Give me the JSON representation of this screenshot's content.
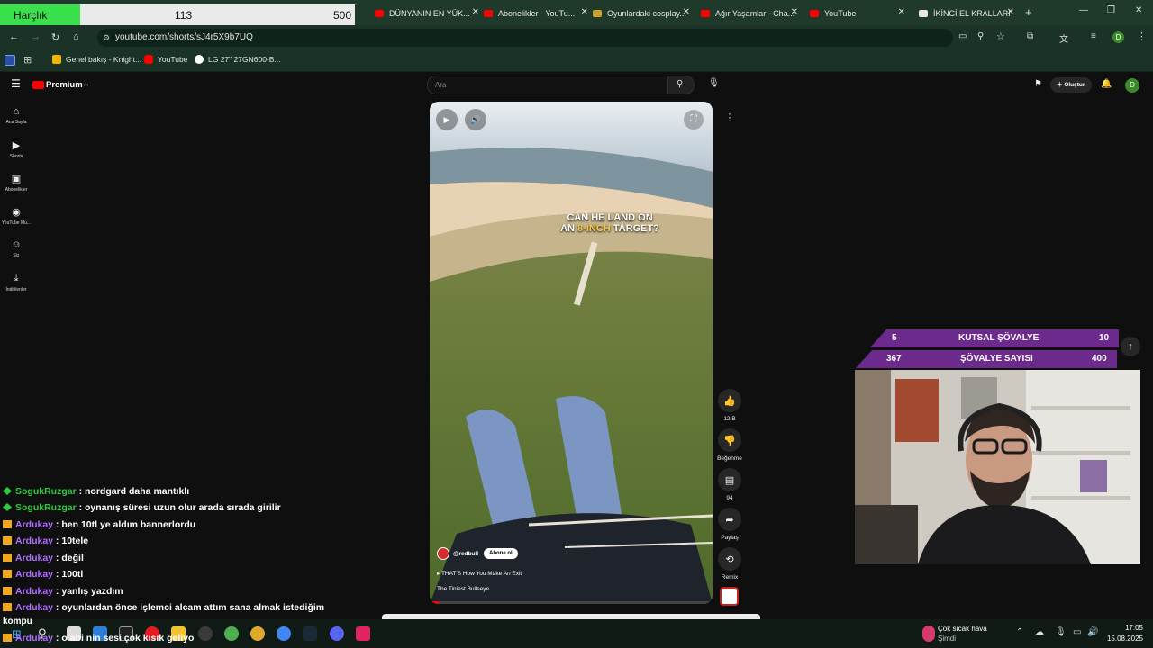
{
  "overlay": {
    "harclik_label": "Harçlık",
    "harclik_current": "113",
    "harclik_max": "500",
    "harclik_progress": 0.226,
    "kutsal_count": "5",
    "kutsal_label": "KUTSAL ŞÖVALYE",
    "kutsal_max": "10",
    "sovalye_count": "367",
    "sovalye_label": "ŞÖVALYE SAYISI",
    "sovalye_max": "400"
  },
  "browser": {
    "tabs": [
      {
        "label": "DÜNYANIN EN YÜK..."
      },
      {
        "label": "Abonelikler - YouTu..."
      },
      {
        "label": "Oyunlardaki cosplay..."
      },
      {
        "label": "Ağır Yaşamlar - Cha..."
      },
      {
        "label": "YouTube"
      },
      {
        "label": "İKİNCİ EL KRALLARI"
      }
    ],
    "url": "youtube.com/shorts/sJ4r5X9b7UQ",
    "bookmarks": [
      {
        "label": "Genel bakış - Knight..."
      },
      {
        "label": "YouTube"
      },
      {
        "label": "LG 27\" 27GN600-B..."
      }
    ]
  },
  "youtube": {
    "logo": "Premium",
    "logo_sup": "TR",
    "search_placeholder": "Ara",
    "create_label": "Oluştur",
    "avatar_letter": "D",
    "sidebar": [
      {
        "label": "Ana Sayfa",
        "icon": "home-icon"
      },
      {
        "label": "Shorts",
        "icon": "shorts-icon"
      },
      {
        "label": "Abonelikler",
        "icon": "subscriptions-icon"
      },
      {
        "label": "YouTube Mu...",
        "icon": "music-icon"
      },
      {
        "label": "Siz",
        "icon": "user-icon"
      },
      {
        "label": "İndirilenler",
        "icon": "download-icon"
      }
    ],
    "video": {
      "caption_line1": "CAN HE LAND ON",
      "caption_line2a": "AN ",
      "caption_line2b": "8-INCH",
      "caption_line2c": " TARGET?",
      "channel": "@redbull",
      "subscribe": "Abone ol",
      "title_line1": "THAT'S How You Make An Exit",
      "title_line2": "The Tiniest Bullseye"
    },
    "actions": {
      "likes": "12 B",
      "dislike": "Beğenme",
      "comments": "94",
      "share": "Paylaş",
      "remix": "Remix"
    }
  },
  "chat": [
    {
      "user": "SogukRuzgar",
      "message": "nordgard daha mantıklı",
      "color": "#2ecc40"
    },
    {
      "user": "SogukRuzgar",
      "message": "oynanış süresi uzun olur arada sırada girilir",
      "color": "#2ecc40"
    },
    {
      "user": "Ardukay",
      "message": "ben 10tl ye aldım bannerlordu",
      "color": "#b070ff"
    },
    {
      "user": "Ardukay",
      "message": "10tele",
      "color": "#b070ff"
    },
    {
      "user": "Ardukay",
      "message": "değil",
      "color": "#b070ff"
    },
    {
      "user": "Ardukay",
      "message": "100tl",
      "color": "#b070ff"
    },
    {
      "user": "Ardukay",
      "message": "yanlış yazdım",
      "color": "#b070ff"
    },
    {
      "user": "Ardukay",
      "message": "oyunlardan önce işlemci alcam attım sana almak istediğim",
      "color": "#b070ff"
    },
    {
      "user": "Ardukay",
      "message": "o abi nin sesi çok kısık geliyo",
      "color": "#b070ff"
    }
  ],
  "chat_wrap": "kompu",
  "taskbar": {
    "weather_line1": "Çok sıcak hava",
    "weather_line2": "Şimdi",
    "time": "17:05",
    "date": "15.08.2025"
  }
}
